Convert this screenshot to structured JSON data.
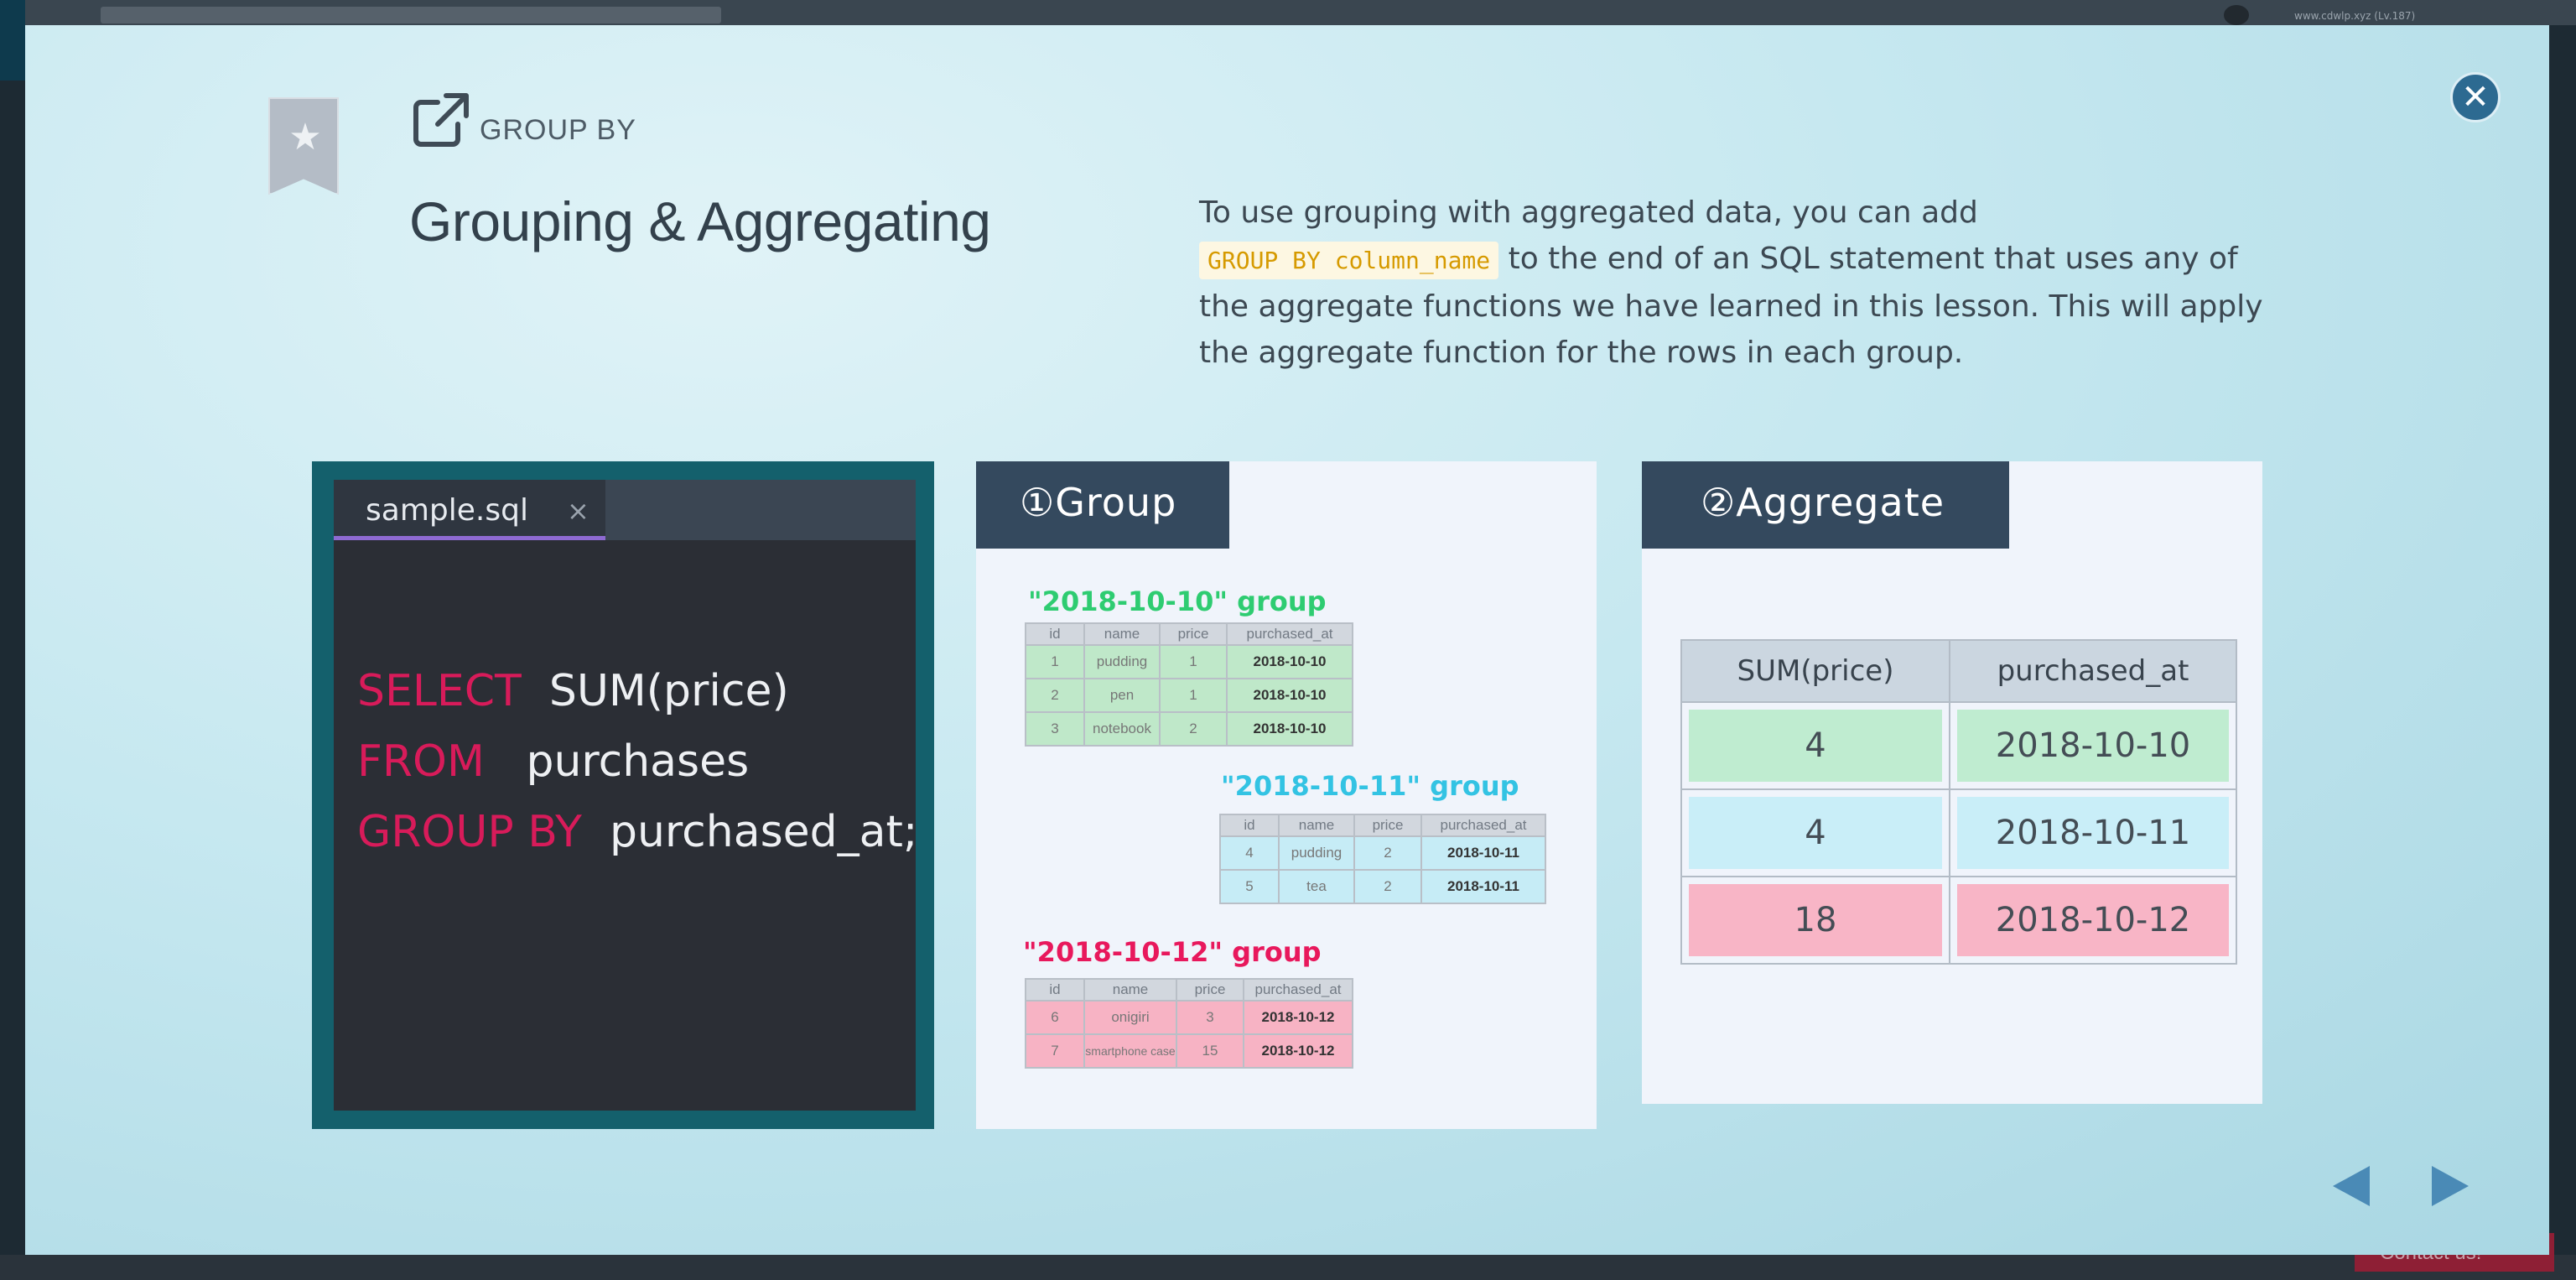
{
  "background_page": {
    "user_text": "www.cdwlp.xyz (Lv.187)",
    "contact_label": "Contact us!"
  },
  "header": {
    "eyebrow": "GROUP BY",
    "title": "Grouping & Aggregating",
    "bookmark_icon": "star-icon",
    "external_icon": "external-link-icon",
    "close_icon": "close-icon"
  },
  "description": {
    "before": "To use grouping with aggregated data, you can add",
    "code": "GROUP BY column_name",
    "after": " to the end of an SQL statement that uses any of the aggregate functions we have learned in this lesson. This will apply the aggregate function for the rows in each group."
  },
  "editor": {
    "tab_name": "sample.sql",
    "tab_close": "×",
    "lines": [
      {
        "kw": "SELECT",
        "val": "SUM(price)"
      },
      {
        "kw": "FROM",
        "val": "purchases"
      },
      {
        "kw": "GROUP BY",
        "val": "purchased_at;"
      }
    ]
  },
  "group_panel": {
    "header": "①Group",
    "columns": [
      "id",
      "name",
      "price",
      "purchased_at"
    ],
    "groups": [
      {
        "label": "\"2018-10-10\" group",
        "color": "#2ecc71",
        "rows": [
          [
            "1",
            "pudding",
            "1",
            "2018-10-10"
          ],
          [
            "2",
            "pen",
            "1",
            "2018-10-10"
          ],
          [
            "3",
            "notebook",
            "2",
            "2018-10-10"
          ]
        ]
      },
      {
        "label": "\"2018-10-11\" group",
        "color": "#33c3e3",
        "rows": [
          [
            "4",
            "pudding",
            "2",
            "2018-10-11"
          ],
          [
            "5",
            "tea",
            "2",
            "2018-10-11"
          ]
        ]
      },
      {
        "label": "\"2018-10-12\" group",
        "color": "#e8185c",
        "rows": [
          [
            "6",
            "onigiri",
            "3",
            "2018-10-12"
          ],
          [
            "7",
            "smartphone case",
            "15",
            "2018-10-12"
          ]
        ]
      }
    ]
  },
  "aggregate_panel": {
    "header": "②Aggregate",
    "columns": [
      "SUM(price)",
      "purchased_at"
    ],
    "rows": [
      [
        "4",
        "2018-10-10"
      ],
      [
        "4",
        "2018-10-11"
      ],
      [
        "18",
        "2018-10-12"
      ]
    ]
  },
  "navigation": {
    "prev_icon": "arrow-left-icon",
    "next_icon": "arrow-right-icon",
    "arrow_color": "#4a8ab6"
  }
}
